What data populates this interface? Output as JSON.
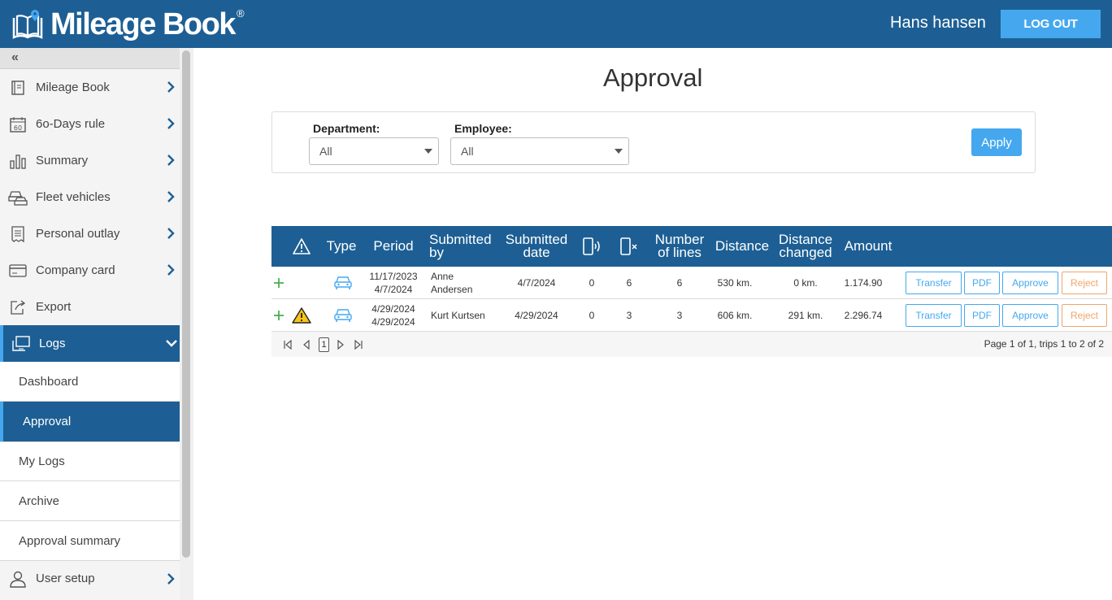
{
  "app": {
    "logo_text": "Mileage Book",
    "logo_reg": "®"
  },
  "header": {
    "user_name": "Hans hansen",
    "logout_label": "LOG OUT"
  },
  "sidebar": {
    "collapse_icon": "«",
    "items": [
      {
        "label": "Mileage Book",
        "icon": "book-icon"
      },
      {
        "label": "6o-Days rule",
        "icon": "calendar-60-icon"
      },
      {
        "label": "Summary",
        "icon": "bar-chart-icon"
      },
      {
        "label": "Fleet vehicles",
        "icon": "cars-icon"
      },
      {
        "label": "Personal outlay",
        "icon": "receipt-icon"
      },
      {
        "label": "Company card",
        "icon": "credit-card-icon"
      },
      {
        "label": "Export",
        "icon": "export-icon"
      },
      {
        "label": "Logs",
        "icon": "logs-icon"
      }
    ],
    "logs_subitems": [
      {
        "label": "Dashboard"
      },
      {
        "label": "Approval"
      },
      {
        "label": "My Logs"
      },
      {
        "label": "Archive"
      },
      {
        "label": "Approval summary"
      }
    ],
    "user_setup": {
      "label": "User setup",
      "icon": "user-icon"
    }
  },
  "main": {
    "title": "Approval",
    "filters": {
      "department_label": "Department:",
      "department_value": "All",
      "employee_label": "Employee:",
      "employee_value": "All",
      "apply_label": "Apply"
    },
    "table": {
      "headers": {
        "warning": "warning-icon",
        "type": "Type",
        "period": "Period",
        "submitted_by": "Submitted by",
        "submitted_date": "Submitted date",
        "phone_signal": "phone-signal-icon",
        "phone_x": "phone-x-icon",
        "number_of_lines": "Number of lines",
        "distance": "Distance",
        "distance_changed": "Distance changed",
        "amount": "Amount"
      },
      "rows": [
        {
          "has_warning": false,
          "period_start": "11/17/2023",
          "period_end": "4/7/2024",
          "submitted_by": "Anne Andersen",
          "submitted_date": "4/7/2024",
          "col_signal": "0",
          "col_x": "6",
          "number_of_lines": "6",
          "distance": "530 km.",
          "distance_changed": "0 km.",
          "amount": "1.174.90"
        },
        {
          "has_warning": true,
          "period_start": "4/29/2024",
          "period_end": "4/29/2024",
          "submitted_by": "Kurt Kurtsen",
          "submitted_date": "4/29/2024",
          "col_signal": "0",
          "col_x": "3",
          "number_of_lines": "3",
          "distance": "606 km.",
          "distance_changed": "291 km.",
          "amount": "2.296.74"
        }
      ],
      "actions": {
        "transfer": "Transfer",
        "pdf": "PDF",
        "approve": "Approve",
        "reject": "Reject"
      }
    },
    "pager": {
      "current_page": "1",
      "info": "Page 1 of 1, trips 1 to 2 of 2"
    }
  },
  "colors": {
    "brand": "#1d5f94",
    "accent": "#45a8ef",
    "reject": "#f0a56b",
    "add": "#4caf50",
    "warning": "#f5c518"
  }
}
